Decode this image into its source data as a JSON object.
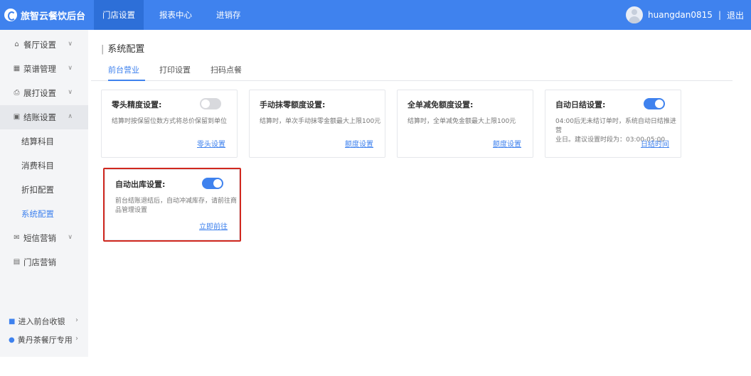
{
  "brand": {
    "name": "旅智云餐饮后台"
  },
  "topnav": [
    {
      "label": "门店设置",
      "active": true
    },
    {
      "label": "报表中心",
      "active": false
    },
    {
      "label": "进销存",
      "active": false
    }
  ],
  "user": {
    "name": "huangdan0815",
    "separator": "|",
    "logout": "退出"
  },
  "sidebar": {
    "items": [
      {
        "label": "餐厅设置",
        "icon": "home-icon"
      },
      {
        "label": "菜谱管理",
        "icon": "grid-icon"
      },
      {
        "label": "展打设置",
        "icon": "printer-icon"
      },
      {
        "label": "结账设置",
        "icon": "receipt-icon"
      },
      {
        "label": "结算科目"
      },
      {
        "label": "消费科目"
      },
      {
        "label": "折扣配置"
      },
      {
        "label": "系统配置"
      },
      {
        "label": "短信营销",
        "icon": "message-icon"
      },
      {
        "label": "门店营销",
        "icon": "store-icon"
      }
    ],
    "bottom": [
      {
        "label": "进入前台收银",
        "icon": "shield-icon"
      },
      {
        "label": "黄丹茶餐厅专用",
        "icon": "location-icon"
      }
    ]
  },
  "page": {
    "title": "系统配置"
  },
  "tabs": [
    {
      "label": "前台营业",
      "active": true
    },
    {
      "label": "打印设置",
      "active": false
    },
    {
      "label": "扫码点餐",
      "active": false
    }
  ],
  "cards": [
    {
      "title": "零头精度设置:",
      "desc": [
        "结算时按保留位数方式将总价保留到单位"
      ],
      "link": "零头设置",
      "switch": false
    },
    {
      "title": "手动抹零额度设置:",
      "desc": [
        "结算时，单次手动抹零金额最大上限100元"
      ],
      "link": "额度设置",
      "switch": null
    },
    {
      "title": "全单减免额度设置:",
      "desc": [
        "结算时，全单减免金额最大上限100元"
      ],
      "link": "额度设置",
      "switch": null
    },
    {
      "title": "自动日结设置:",
      "desc": [
        "04:00后无未结订单时，系统自动日结推进营",
        "业日。建议设置时段为：03:00-05:00"
      ],
      "link": "日结时间",
      "switch": true
    },
    {
      "title": "自动出库设置:",
      "desc": [
        "前台结账退结后，自动冲减库存，请前往商",
        "品管理设置"
      ],
      "link": "立即前往",
      "switch": true
    }
  ],
  "colors": {
    "primary": "#3f82ee",
    "highlight": "#d0281f",
    "sidebar_bg": "#f4f5f7"
  }
}
